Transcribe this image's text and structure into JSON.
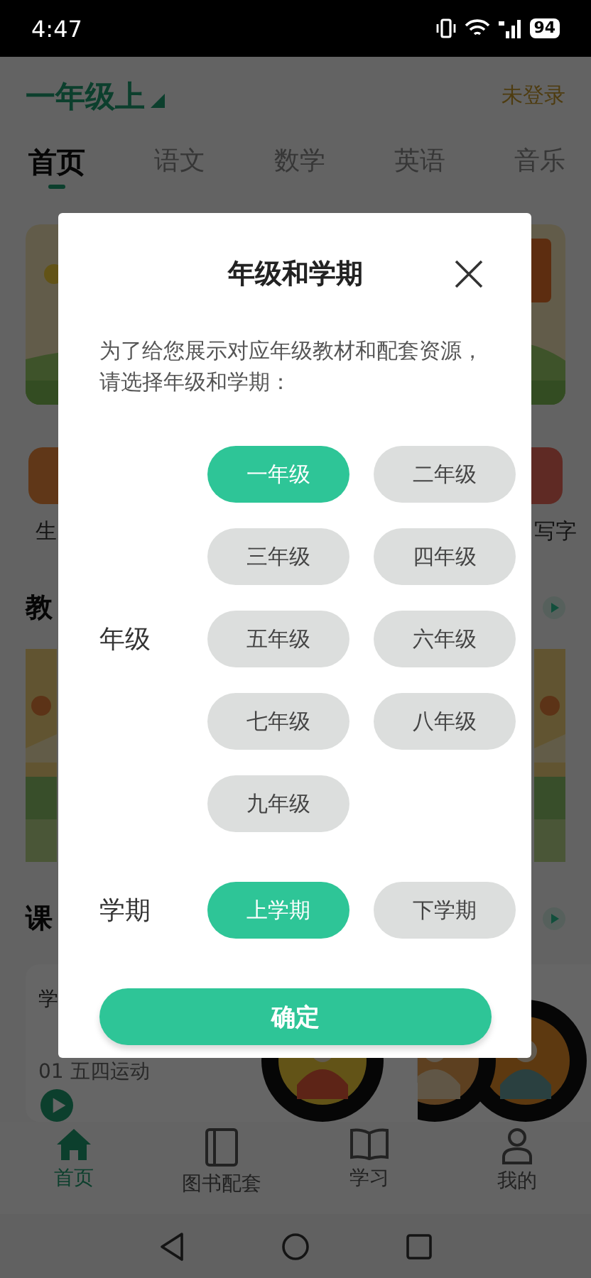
{
  "status_bar": {
    "time": "4:47",
    "battery": "94"
  },
  "header": {
    "grade": "一年级上",
    "login": "未登录"
  },
  "subject_tabs": [
    {
      "label": "首页",
      "selected": true
    },
    {
      "label": "语文",
      "selected": false
    },
    {
      "label": "数学",
      "selected": false
    },
    {
      "label": "英语",
      "selected": false
    },
    {
      "label": "音乐",
      "selected": false
    }
  ],
  "shortcuts": [
    {
      "label": "生"
    },
    {
      "label": "写字"
    }
  ],
  "sections": [
    {
      "title": "教"
    },
    {
      "title": "课"
    }
  ],
  "lesson_card": {
    "title": "学",
    "subtitle": "01 五四运动"
  },
  "bottom_nav": [
    {
      "label": "首页",
      "selected": true
    },
    {
      "label": "图书配套",
      "selected": false
    },
    {
      "label": "学习",
      "selected": false
    },
    {
      "label": "我的",
      "selected": false
    }
  ],
  "dialog": {
    "title": "年级和学期",
    "description": "为了给您展示对应年级教材和配套资源，请选择年级和学期：",
    "grade_label": "年级",
    "grades": [
      {
        "label": "一年级",
        "selected": true
      },
      {
        "label": "二年级",
        "selected": false
      },
      {
        "label": "三年级",
        "selected": false
      },
      {
        "label": "四年级",
        "selected": false
      },
      {
        "label": "五年级",
        "selected": false
      },
      {
        "label": "六年级",
        "selected": false
      },
      {
        "label": "七年级",
        "selected": false
      },
      {
        "label": "八年级",
        "selected": false
      },
      {
        "label": "九年级",
        "selected": false
      }
    ],
    "term_label": "学期",
    "terms": [
      {
        "label": "上学期",
        "selected": true
      },
      {
        "label": "下学期",
        "selected": false
      }
    ],
    "confirm": "确定"
  }
}
